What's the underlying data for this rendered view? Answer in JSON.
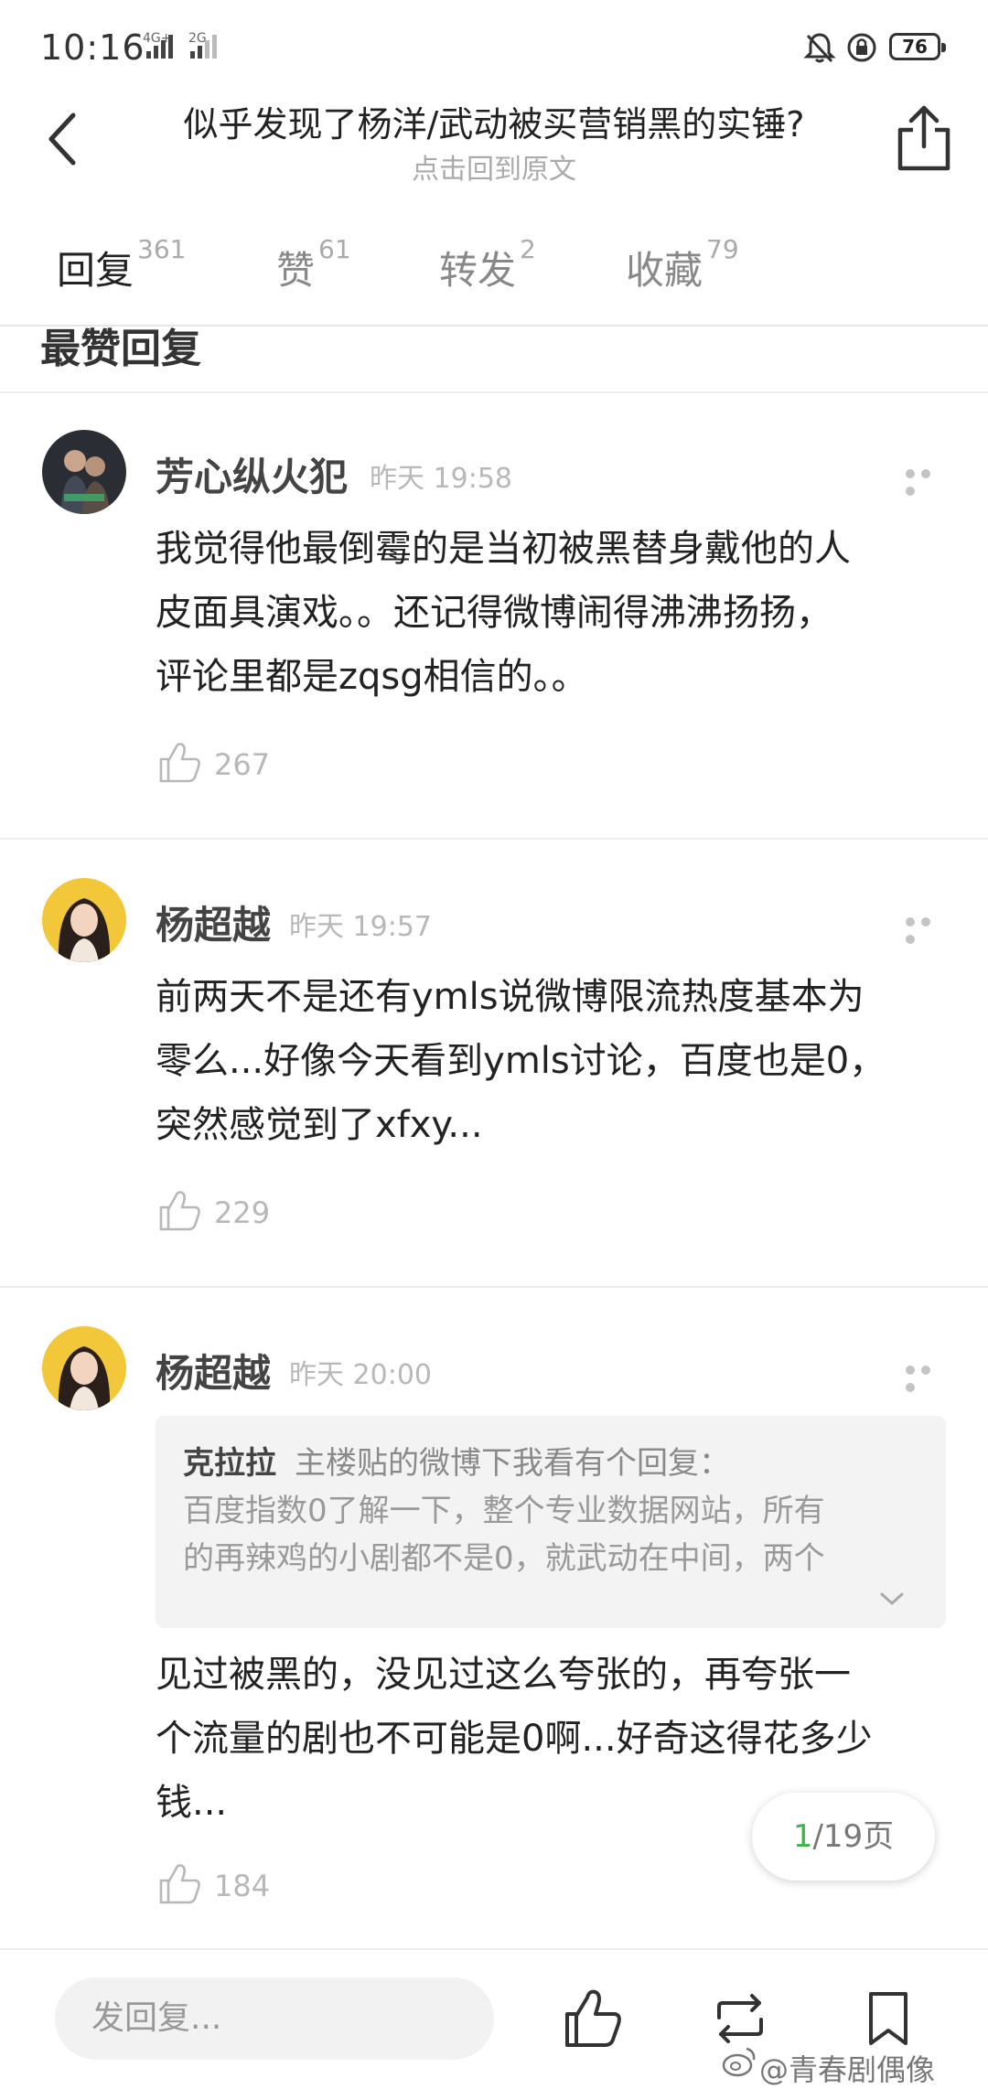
{
  "status_bar": {
    "time": "10:16",
    "network_1": "4G+",
    "network_2": "2G",
    "battery": "76"
  },
  "header": {
    "title": "似乎发现了杨洋/武动被买营销黑的实锤?",
    "subtitle": "点击回到原文"
  },
  "tabs": [
    {
      "label": "回复",
      "count": "361"
    },
    {
      "label": "赞",
      "count": "61"
    },
    {
      "label": "转发",
      "count": "2"
    },
    {
      "label": "收藏",
      "count": "79"
    }
  ],
  "section_title": "最赞回复",
  "comments": [
    {
      "user": "芳心纵火犯",
      "time": "昨天 19:58",
      "lines": [
        "我觉得他最倒霉的是当初被黑替身戴他的人",
        "皮面具演戏。。还记得微博闹得沸沸扬扬，",
        "评论里都是zqsg相信的。。"
      ],
      "likes": "267"
    },
    {
      "user": "杨超越",
      "time": "昨天 19:57",
      "lines": [
        "前两天不是还有ymls说微博限流热度基本为",
        "零么...好像今天看到ymls讨论，百度也是0，",
        "突然感觉到了xfxy..."
      ],
      "likes": "229"
    },
    {
      "user": "杨超越",
      "time": "昨天 20:00",
      "quote": {
        "author": "克拉拉",
        "first": "主楼贴的微博下我看有个回复：",
        "lines": [
          "百度指数0了解一下，整个专业数据网站，所有",
          "的再辣鸡的小剧都不是0，就武动在中间，两个"
        ]
      },
      "lines": [
        "见过被黑的，没见过这么夸张的，再夸张一",
        "个流量的剧也不可能是0啊...好奇这得花多少",
        "钱..."
      ],
      "likes": "184"
    }
  ],
  "pager": {
    "current": "1",
    "total": "/19页"
  },
  "bottom_bar": {
    "reply_placeholder": "发回复..."
  },
  "watermark": "@青春剧偶像"
}
